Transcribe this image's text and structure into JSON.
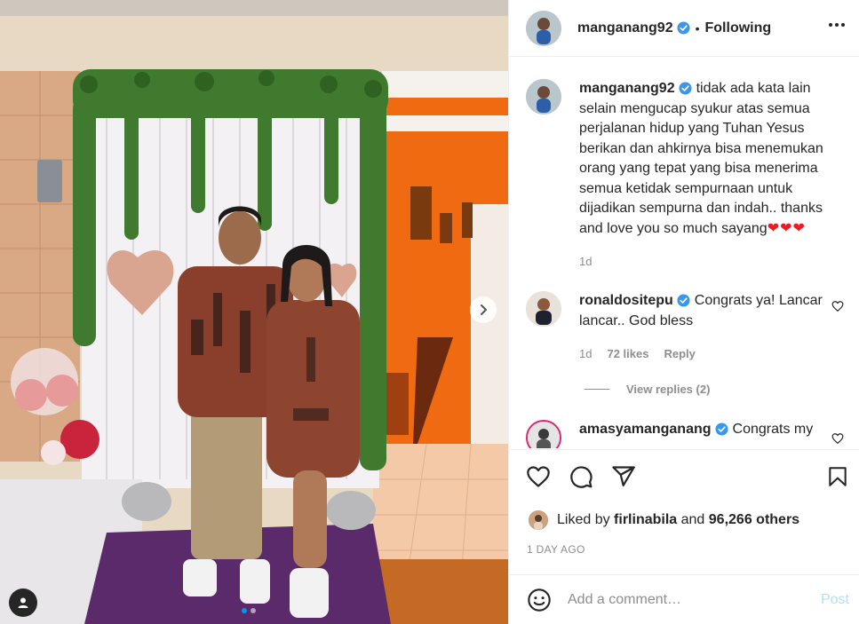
{
  "post": {
    "author": "manganang92",
    "follow_sep": "•",
    "follow_status": "Following",
    "verified": true,
    "carousel": {
      "slides": 2,
      "current": 1
    }
  },
  "caption": {
    "username": "manganang92",
    "text": "tidak ada kata lain selain mengucap syukur atas semua perjalanan hidup yang Tuhan Yesus berikan dan ahkirnya bisa menemukan orang yang tepat yang bisa menerima semua ketidak sempurnaan untuk dijadikan sempurna dan indah.. thanks and love you so much sayang",
    "emoji": "❤❤❤",
    "time": "1d"
  },
  "comments": [
    {
      "username": "ronaldositepu",
      "text": "Congrats ya! Lancar lancar.. God bless",
      "time": "1d",
      "likes": "72 likes",
      "reply": "Reply",
      "view_replies": "View replies (2)"
    },
    {
      "username": "amasyamanganang",
      "text": "Congrats my"
    }
  ],
  "likes": {
    "prefix": "Liked by",
    "user": "firlinabila",
    "middle": "and",
    "others": "96,266 others"
  },
  "timestamp": "1 DAY AGO",
  "add_comment": {
    "placeholder": "Add a comment…",
    "post": "Post"
  },
  "colors": {
    "verified": "#3897f0",
    "accent": "#0095f6",
    "post_disabled": "#b2dffc",
    "muted": "#8e8e8e",
    "heart_emoji": "#ed1c24"
  },
  "icons": {
    "more": "more-horizontal-icon",
    "heart": "heart-icon",
    "comment": "comment-icon",
    "share": "paper-plane-icon",
    "save": "bookmark-icon",
    "emoji": "smiley-icon",
    "next": "chevron-right-icon",
    "tags": "user-tag-icon"
  }
}
